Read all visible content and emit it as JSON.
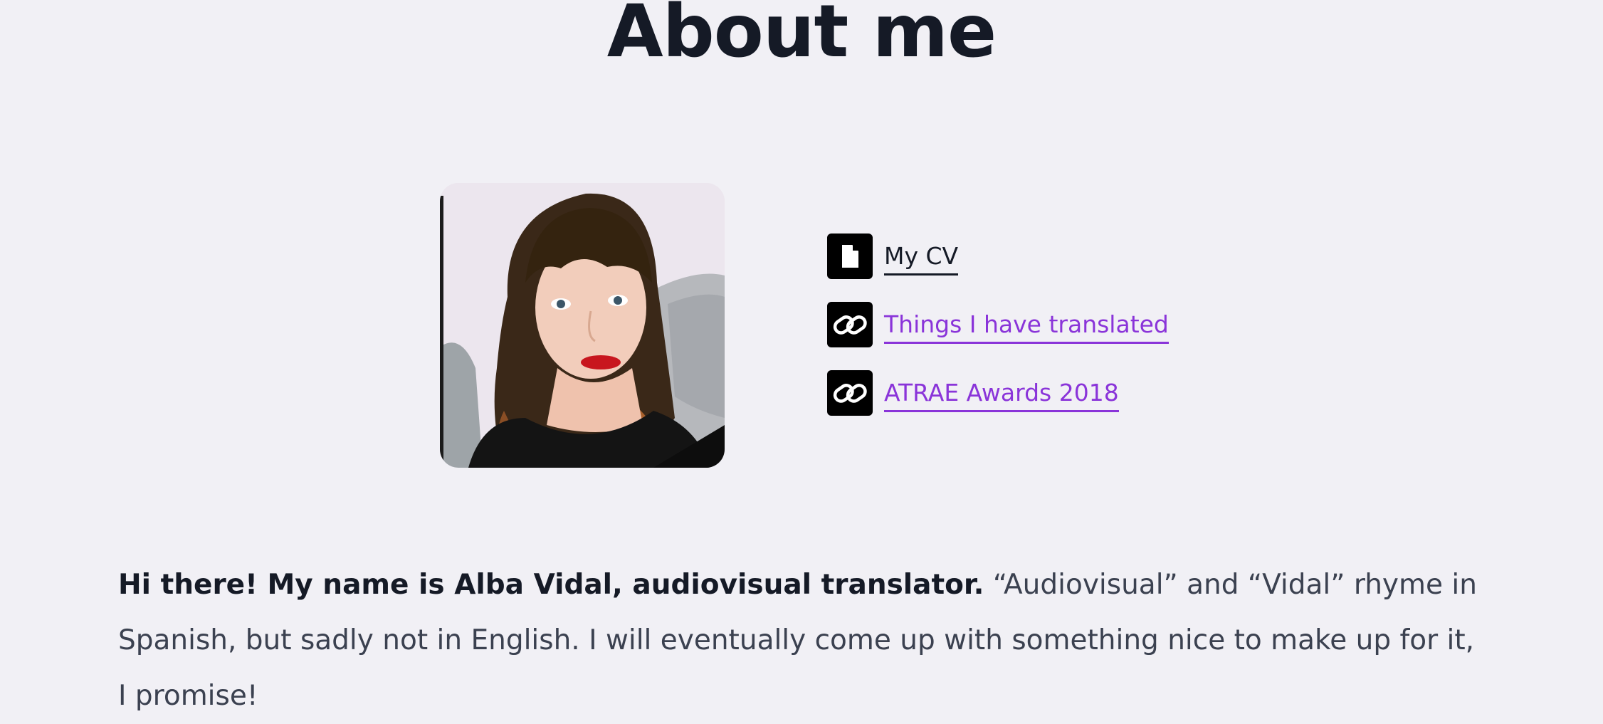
{
  "page": {
    "title": "About me"
  },
  "photo": {
    "alt": "Portrait of Alba Vidal"
  },
  "links": [
    {
      "icon": "document-icon",
      "label": "My CV"
    },
    {
      "icon": "link-icon",
      "label": "Things I have translated"
    },
    {
      "icon": "link-icon",
      "label": "ATRAE Awards 2018"
    }
  ],
  "bio": {
    "intro": "Hi there! My name is Alba Vidal, audiovisual translator.",
    "body": " “Audiovisual” and “Vidal” rhyme in Spanish, but sadly not in English. I will eventually come up with something nice to make up for it, I promise!"
  },
  "colors": {
    "background": "#f1f0f5",
    "heading": "#151a26",
    "body_text": "#3b4150",
    "accent_link": "#8a34d9",
    "icon_bg": "#000000"
  }
}
